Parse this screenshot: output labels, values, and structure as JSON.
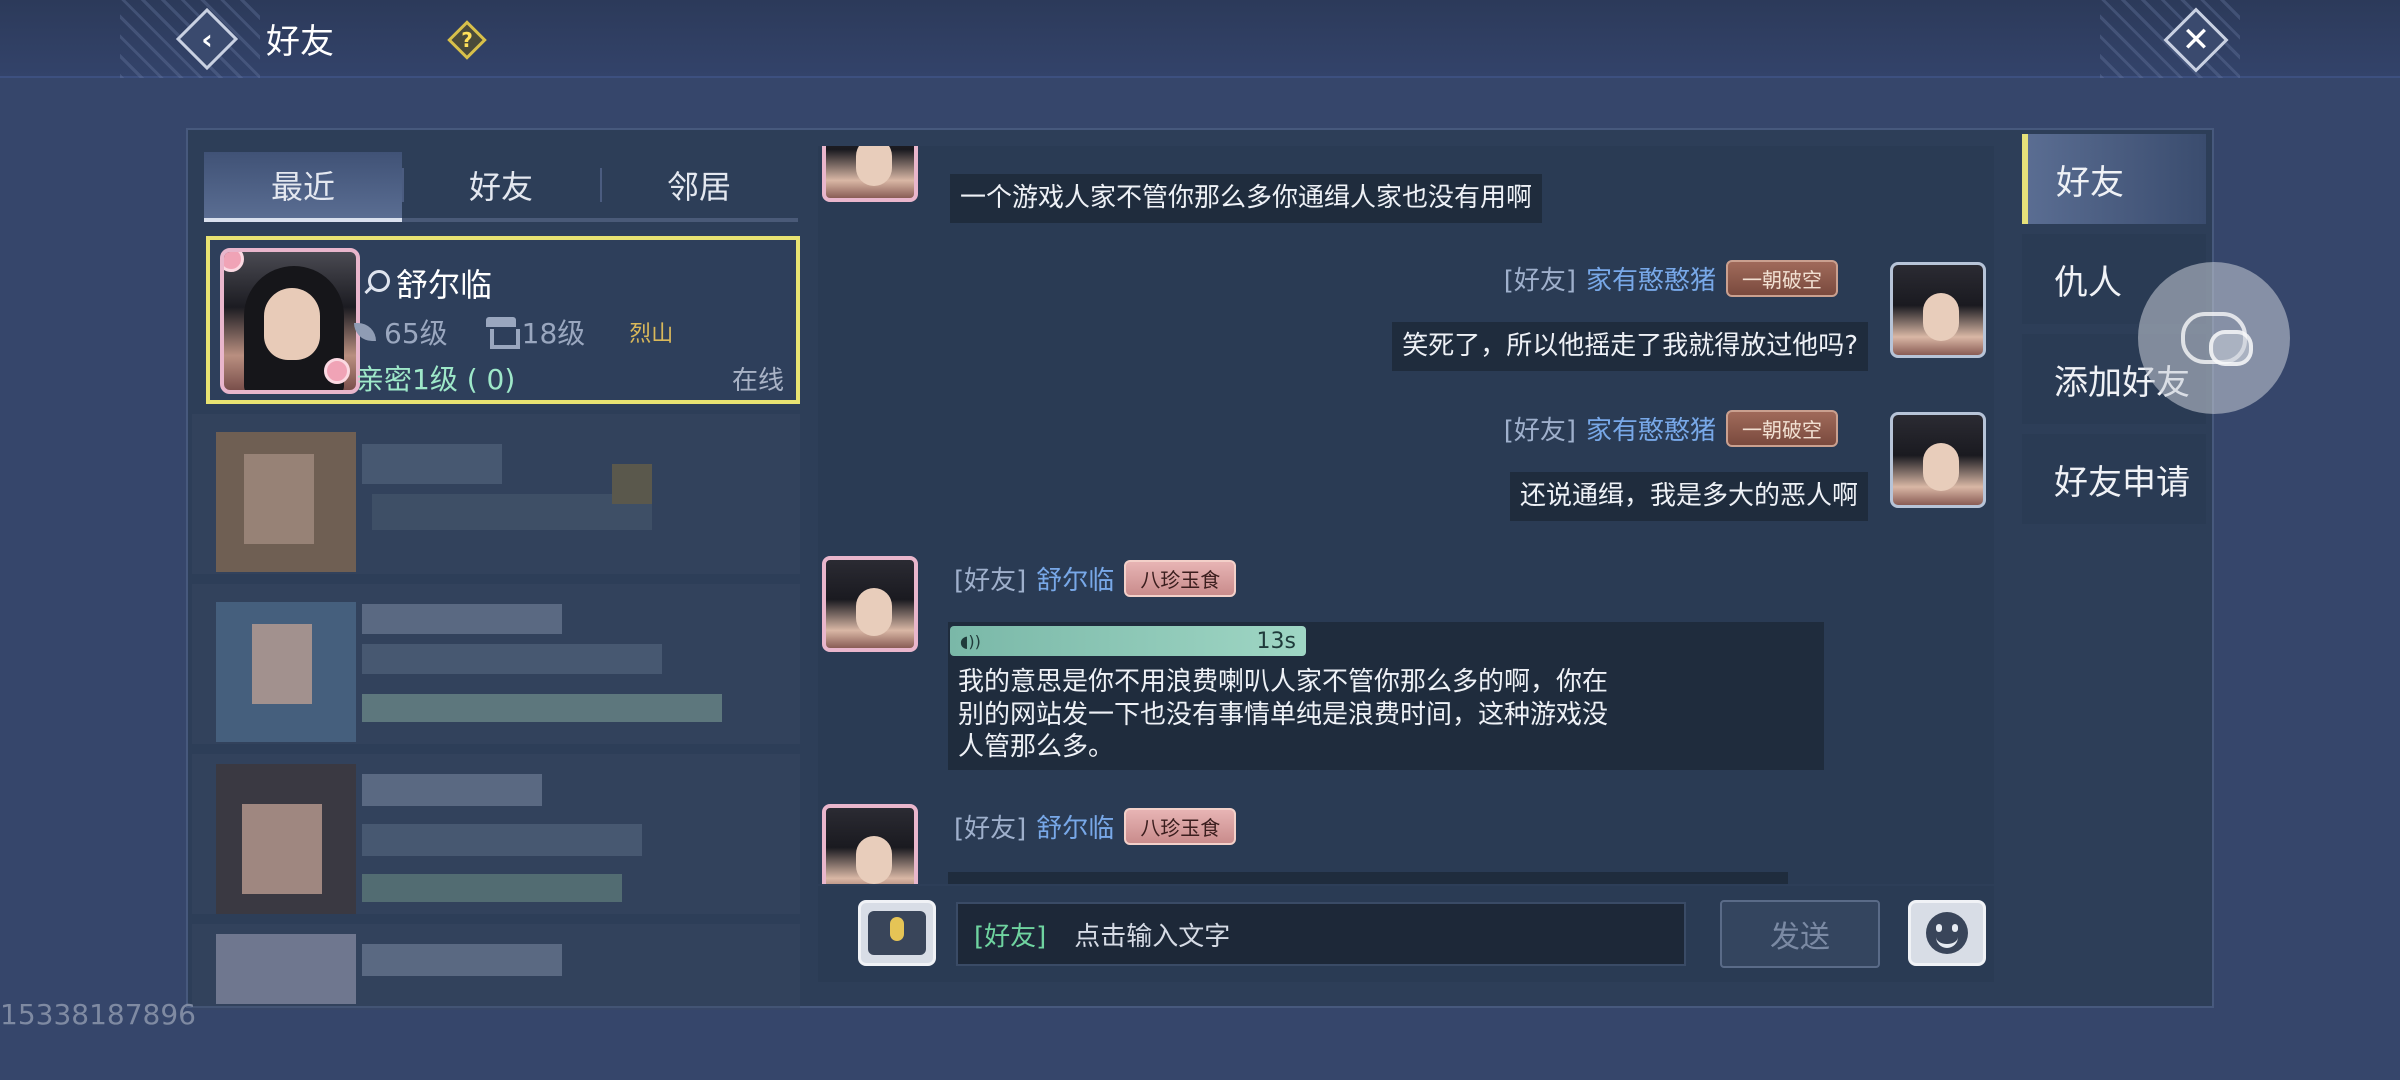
{
  "header": {
    "title": "好友",
    "back_icon": "back-arrow-icon",
    "help_label": "?",
    "close_label": "✕"
  },
  "tabs": [
    {
      "label": "最近",
      "active": true
    },
    {
      "label": "好友",
      "active": false
    },
    {
      "label": "邻居",
      "active": false
    }
  ],
  "selected_friend": {
    "name": "舒尔临",
    "level": "65级",
    "house_level": "18级",
    "server": "烈山",
    "intimacy": "亲密1级 ( 0)",
    "status": "在线"
  },
  "messages": [
    {
      "text": "一个游戏人家不管你那么多你通缉人家也没有用啊"
    },
    {
      "channel": "[好友]",
      "sender": "家有憨憨猪",
      "badge": "一朝破空",
      "text": "笑死了，所以他摇走了我就得放过他吗?"
    },
    {
      "channel": "[好友]",
      "sender": "家有憨憨猪",
      "badge": "一朝破空",
      "text": "还说通缉，我是多大的恶人啊"
    },
    {
      "channel": "[好友]",
      "sender": "舒尔临",
      "badge": "八珍玉食",
      "voice_duration": "13s",
      "text_lines": [
        "我的意思是你不用浪费喇叭人家不管你那么多的啊，你在",
        "别的网站发一下也没有事情单纯是浪费时间，这种游戏没",
        "人管那么多。"
      ]
    },
    {
      "channel": "[好友]",
      "sender": "舒尔临",
      "badge": "八珍玉食"
    }
  ],
  "input": {
    "channel": "[好友]",
    "placeholder": "点击输入文字",
    "send_label": "发送"
  },
  "side_menu": [
    {
      "label": "好友",
      "active": true
    },
    {
      "label": "仇人",
      "active": false
    },
    {
      "label": "添加好友",
      "active": false
    },
    {
      "label": "好友申请",
      "active": false
    }
  ],
  "watermark": "15338187896",
  "colors": {
    "background": "#36466b",
    "panel": "#2d3e58",
    "highlight_border": "#e8e372",
    "sender_blue": "#78a8e8",
    "intimacy_green": "#9ee8c9",
    "voice_bar": "#9fd6c4"
  }
}
